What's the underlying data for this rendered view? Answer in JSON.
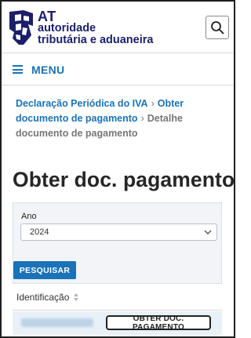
{
  "header": {
    "brand_at": "AT",
    "brand_line1": "autoridade",
    "brand_line2": "tributária e aduaneira",
    "brand_color": "#1b1f6b"
  },
  "menu": {
    "label": "MENU",
    "accent": "#1a73b8"
  },
  "breadcrumb": {
    "items": [
      {
        "label": "Declaração Periódica do IVA"
      },
      {
        "label": "Obter documento de pagamento"
      },
      {
        "label": "Detalhe documento de pagamento"
      }
    ]
  },
  "page": {
    "title": "Obter doc. pagamento"
  },
  "form": {
    "year_label": "Ano",
    "year_value": "2024",
    "search_button": "PESQUISAR"
  },
  "table": {
    "columns": [
      {
        "label": "Identificação"
      }
    ],
    "rows": [
      {
        "action_label": "OBTER DOC. PAGAMENTO"
      }
    ]
  },
  "icons": {
    "logo": "at-shield-logo",
    "search": "search-icon",
    "menu": "hamburger-icon",
    "select": "chevron-down-icon",
    "sort": "sort-icon"
  }
}
